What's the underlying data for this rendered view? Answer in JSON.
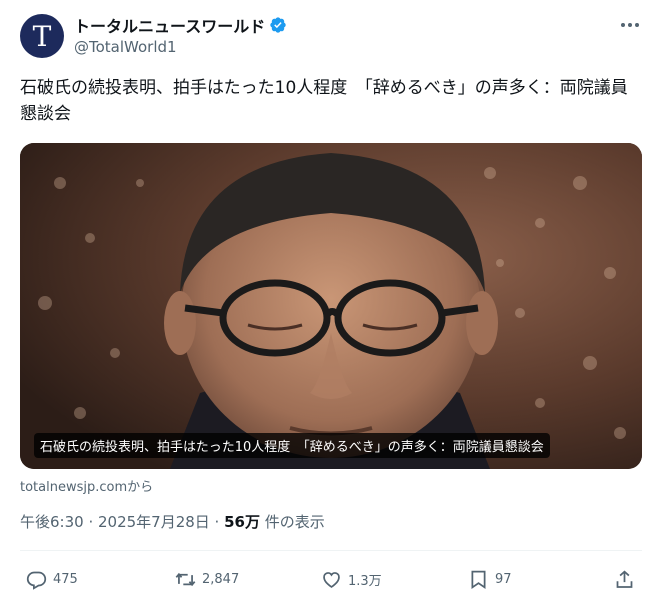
{
  "account": {
    "avatar_letter": "T",
    "display_name": "トータルニュースワールド",
    "handle": "@TotalWorld1",
    "verified_icon": "verified-badge-icon",
    "avatar_color": "#1d2a5c"
  },
  "tweet": {
    "text": "石破氏の続投表明、拍手はたった10人程度　「辞めるべき」の声多く：両院議員懇談会"
  },
  "card": {
    "caption": "石破氏の続投表明、拍手はたった10人程度　「辞めるべき」の声多く：両院議員懇談会",
    "source": "totalnewsjp.comから"
  },
  "meta": {
    "time": "午後6:30 · 2025年7月28日 · ",
    "views": "56万",
    "views_suffix": " 件の表示"
  },
  "actions": {
    "reply_count": "475",
    "retweet_count": "2,847",
    "like_count": "1.3万",
    "bookmark_count": "97"
  },
  "colors": {
    "verified": "#1d9bf0",
    "secondary_text": "#536471",
    "primary_text": "#0f1419"
  }
}
